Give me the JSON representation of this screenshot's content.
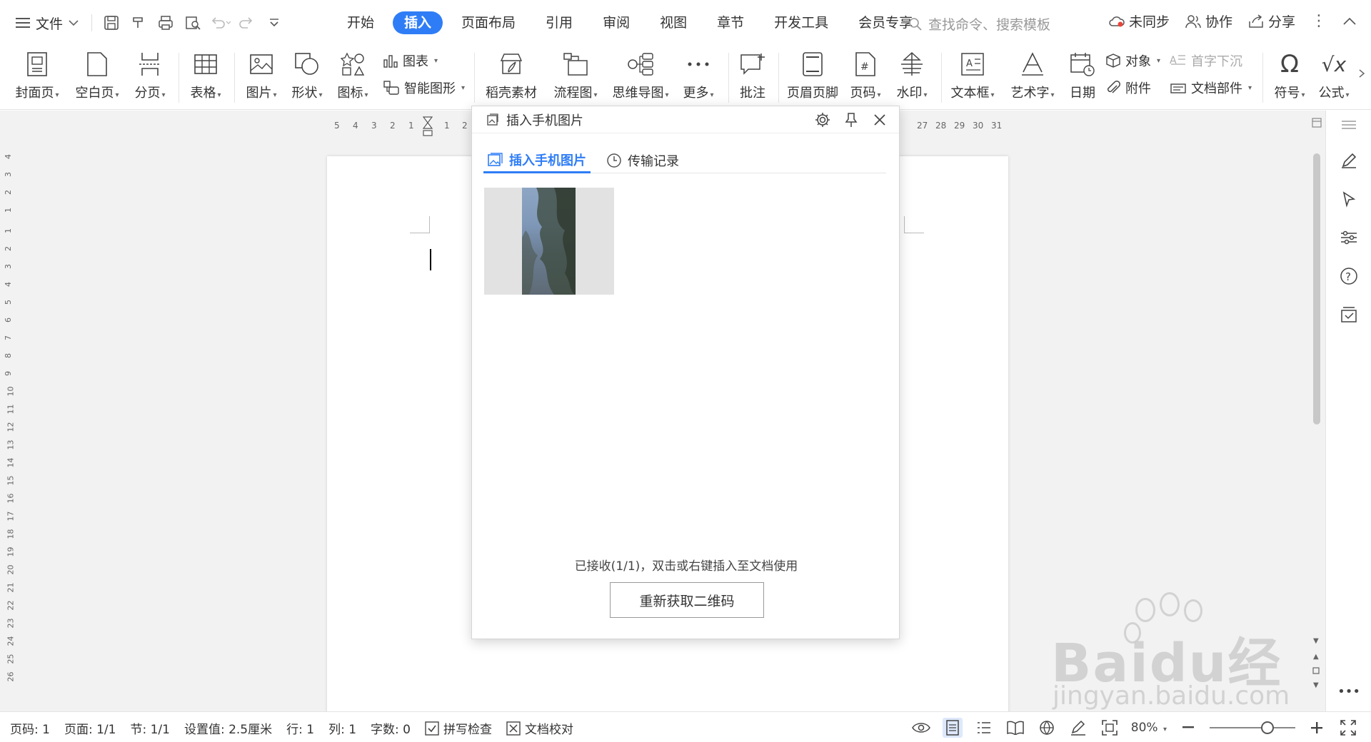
{
  "titlebar": {
    "file_menu": "文件",
    "tabs": [
      {
        "label": "开始",
        "active": false
      },
      {
        "label": "插入",
        "active": true
      },
      {
        "label": "页面布局",
        "active": false
      },
      {
        "label": "引用",
        "active": false
      },
      {
        "label": "审阅",
        "active": false
      },
      {
        "label": "视图",
        "active": false
      },
      {
        "label": "章节",
        "active": false
      },
      {
        "label": "开发工具",
        "active": false
      },
      {
        "label": "会员专享",
        "active": false
      }
    ],
    "search_placeholder": "查找命令、搜索模板",
    "sync": "未同步",
    "collaborate": "协作",
    "share": "分享"
  },
  "ribbon": {
    "cover_page": "封面页",
    "blank_page": "空白页",
    "page_break": "分页",
    "table": "表格",
    "picture": "图片",
    "shape": "形状",
    "icon": "图标",
    "chart": "图表",
    "smart_art": "智能图形",
    "docer_material": "稻壳素材",
    "flowchart": "流程图",
    "mind_map": "思维导图",
    "more": "更多",
    "comment": "批注",
    "header_footer": "页眉页脚",
    "page_number": "页码",
    "watermark": "水印",
    "text_box": "文本框",
    "word_art": "艺术字",
    "date": "日期",
    "object": "对象",
    "drop_cap": "首字下沉",
    "attachment": "附件",
    "doc_parts": "文档部件",
    "symbol": "符号",
    "formula": "公式"
  },
  "ruler": {
    "h_left": [
      "5",
      "4",
      "3",
      "2",
      "1",
      "1",
      "2"
    ],
    "h_right": [
      "27",
      "28",
      "29",
      "30",
      "31"
    ],
    "v_top": [
      "4",
      "3",
      "2",
      "1"
    ],
    "v_main": [
      "1",
      "2",
      "3",
      "4",
      "5",
      "6",
      "7",
      "8",
      "9",
      "10",
      "11",
      "12",
      "13",
      "14",
      "15",
      "16",
      "17",
      "18",
      "19",
      "20",
      "21",
      "22",
      "23",
      "24",
      "25",
      "26"
    ]
  },
  "dialog": {
    "title": "插入手机图片",
    "tab_insert": "插入手机图片",
    "tab_history": "传输记录",
    "status": "已接收(1/1)，双击或右键插入至文档使用",
    "refresh_button": "重新获取二维码"
  },
  "statusbar": {
    "page_code": "页码: 1",
    "page": "页面: 1/1",
    "section": "节: 1/1",
    "setting": "设置值: 2.5厘米",
    "row": "行: 1",
    "col": "列: 1",
    "word_count": "字数: 0",
    "spell_check": "拼写检查",
    "doc_proof": "文档校对",
    "zoom": "80%"
  },
  "watermark": {
    "brand": "Baidu经验",
    "url": "jingyan.baidu.com"
  },
  "colors": {
    "accent": "#2f7df6"
  }
}
